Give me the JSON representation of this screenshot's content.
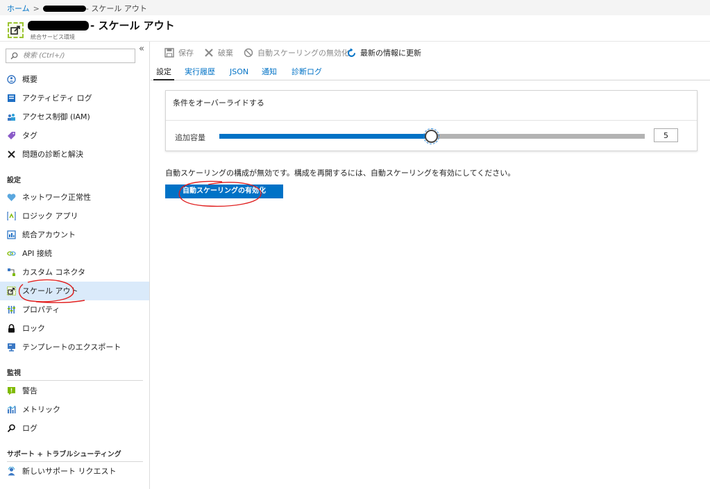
{
  "breadcrumb": {
    "home": "ホーム",
    "separator": ">",
    "current": "- スケール アウト"
  },
  "header": {
    "title": "- スケール アウト",
    "subtitle": "統合サービス環境"
  },
  "search": {
    "placeholder": "検索 (Ctrl+/)",
    "value": ""
  },
  "sidebar": {
    "collapse_glyph": "«",
    "items_top": [
      {
        "label": "概要",
        "icon": "overview-icon"
      },
      {
        "label": "アクティビティ ログ",
        "icon": "activity-log-icon"
      },
      {
        "label": "アクセス制御 (IAM)",
        "icon": "access-control-icon"
      },
      {
        "label": "タグ",
        "icon": "tag-icon"
      },
      {
        "label": "問題の診断と解決",
        "icon": "tools-icon"
      }
    ],
    "section_settings": "設定",
    "items_settings": [
      {
        "label": "ネットワーク正常性",
        "icon": "heart-icon"
      },
      {
        "label": "ロジック アプリ",
        "icon": "logic-app-icon"
      },
      {
        "label": "統合アカウント",
        "icon": "integration-account-icon"
      },
      {
        "label": "API 接続",
        "icon": "link-icon"
      },
      {
        "label": "カスタム コネクタ",
        "icon": "connector-icon"
      },
      {
        "label": "スケール アウト",
        "icon": "scale-out-icon",
        "active": true
      },
      {
        "label": "プロパティ",
        "icon": "properties-icon"
      },
      {
        "label": "ロック",
        "icon": "lock-icon"
      },
      {
        "label": "テンプレートのエクスポート",
        "icon": "export-template-icon"
      }
    ],
    "section_monitoring": "監視",
    "items_monitoring": [
      {
        "label": "警告",
        "icon": "alert-icon"
      },
      {
        "label": "メトリック",
        "icon": "metrics-icon"
      },
      {
        "label": "ログ",
        "icon": "search-log-icon"
      }
    ],
    "section_support": "サポート + トラブルシューティング",
    "items_support": [
      {
        "label": "新しいサポート リクエスト",
        "icon": "support-icon"
      }
    ]
  },
  "toolbar": {
    "save": "保存",
    "discard": "破棄",
    "disable_autoscale": "自動スケーリングの無効化",
    "refresh": "最新の情報に更新"
  },
  "tabs": [
    "設定",
    "実行履歴",
    "JSON",
    "通知",
    "診断ログ"
  ],
  "active_tab": "設定",
  "condition": {
    "title": "条件をオーバーライドする",
    "capacity_label": "追加容量",
    "capacity_value": "5",
    "slider_fraction": 0.498
  },
  "message": "自動スケーリングの構成が無効です。構成を再開するには、自動スケーリングを有効にしてください。",
  "enable_button": "自動スケーリングの有効化",
  "colors": {
    "accent": "#0072c6",
    "active_nav": "#daeafa",
    "annotation": "#e02020"
  }
}
